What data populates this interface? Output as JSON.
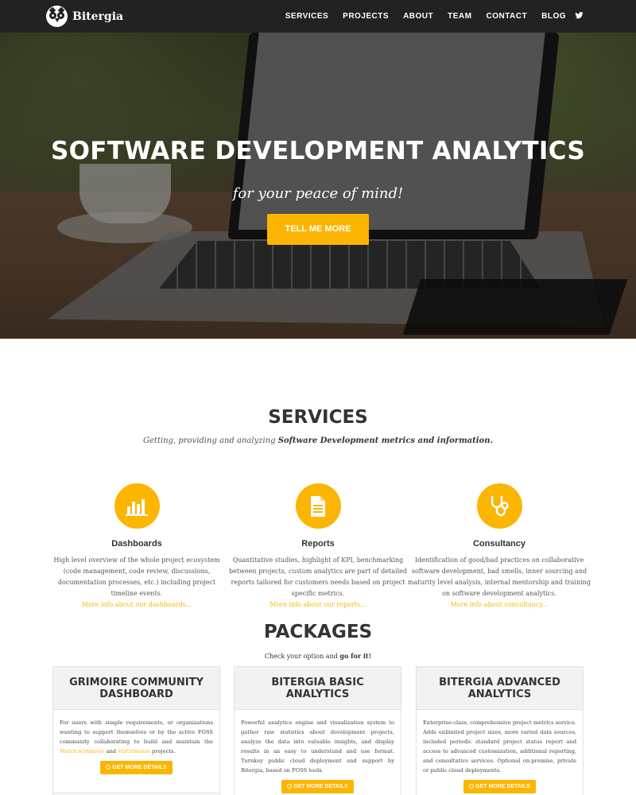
{
  "navbar": {
    "brand": "Bitergia",
    "links": [
      "SERVICES",
      "PROJECTS",
      "ABOUT",
      "TEAM",
      "CONTACT",
      "BLOG"
    ],
    "social_icon": "twitter-icon"
  },
  "hero": {
    "title": "SOFTWARE DEVELOPMENT ANALYTICS",
    "subtitle": "for your peace of mind!",
    "button": "TELL ME MORE"
  },
  "services": {
    "title": "SERVICES",
    "subtitle_plain": "Getting, providing and analyzing ",
    "subtitle_bold": "Software Development metrics and information.",
    "items": [
      {
        "icon": "bar-chart-icon",
        "name": "Dashboards",
        "description": "High level overview of the whole project ecosystem (code management, code review, discussions, documentation processes, etc.) including project timeline events.",
        "link": "More info about our dashboards..."
      },
      {
        "icon": "document-icon",
        "name": "Reports",
        "description": "Quantitative studies, highlight of KPI, benchmarking between projects, custom analytics are part of detailed reports tailored for customers needs based on project specific metrics.",
        "link": "More info about our reports..."
      },
      {
        "icon": "stethoscope-icon",
        "name": "Consultancy",
        "description": "Identification of good/bad practices on collaborative software development, bad smells, inner sourcing and maturity level analysis, internal mentorship and training on software development analytics.",
        "link": "More info about consultancy..."
      }
    ]
  },
  "packages": {
    "title": "PACKAGES",
    "subtitle_plain": "Check your option and ",
    "subtitle_bold": "go for it!",
    "items": [
      {
        "name": "GRIMOIRE COMMUNITY DASHBOARD",
        "description_before": "For users with simple requirements, or organizations wanting to support themselves or by the active FOSS community collaborating to build and maintain the ",
        "link1": "MetricsGrimoire",
        "description_mid": " and ",
        "link2": "VizGrimoire",
        "description_after": " projects.",
        "button": "GET MORE DETAILS"
      },
      {
        "name": "BITERGIA BASIC ANALYTICS",
        "description": "Powerful analytics engine and visualization system to gather raw statistics about development projects, analyze the data into valuable insights, and display results in an easy to understand and use format. Turnkey public cloud deployment and support by Bitergia, based on FOSS tools.",
        "button": "GET MORE DETAILS"
      },
      {
        "name": "BITERGIA ADVANCED ANALYTICS",
        "description": "Enterprise-class, comprehensive project metrics service. Adds unlimited project sizes, more varied data sources, included periodic standard project status report and access to advanced customization, additional reporting, and consultative services. Optional on-premise, private or public cloud deployments.",
        "button": "GET MORE DETAILS"
      }
    ]
  },
  "colors": {
    "accent": "#fcb501",
    "navbar": "#222222",
    "text": "#333333"
  }
}
